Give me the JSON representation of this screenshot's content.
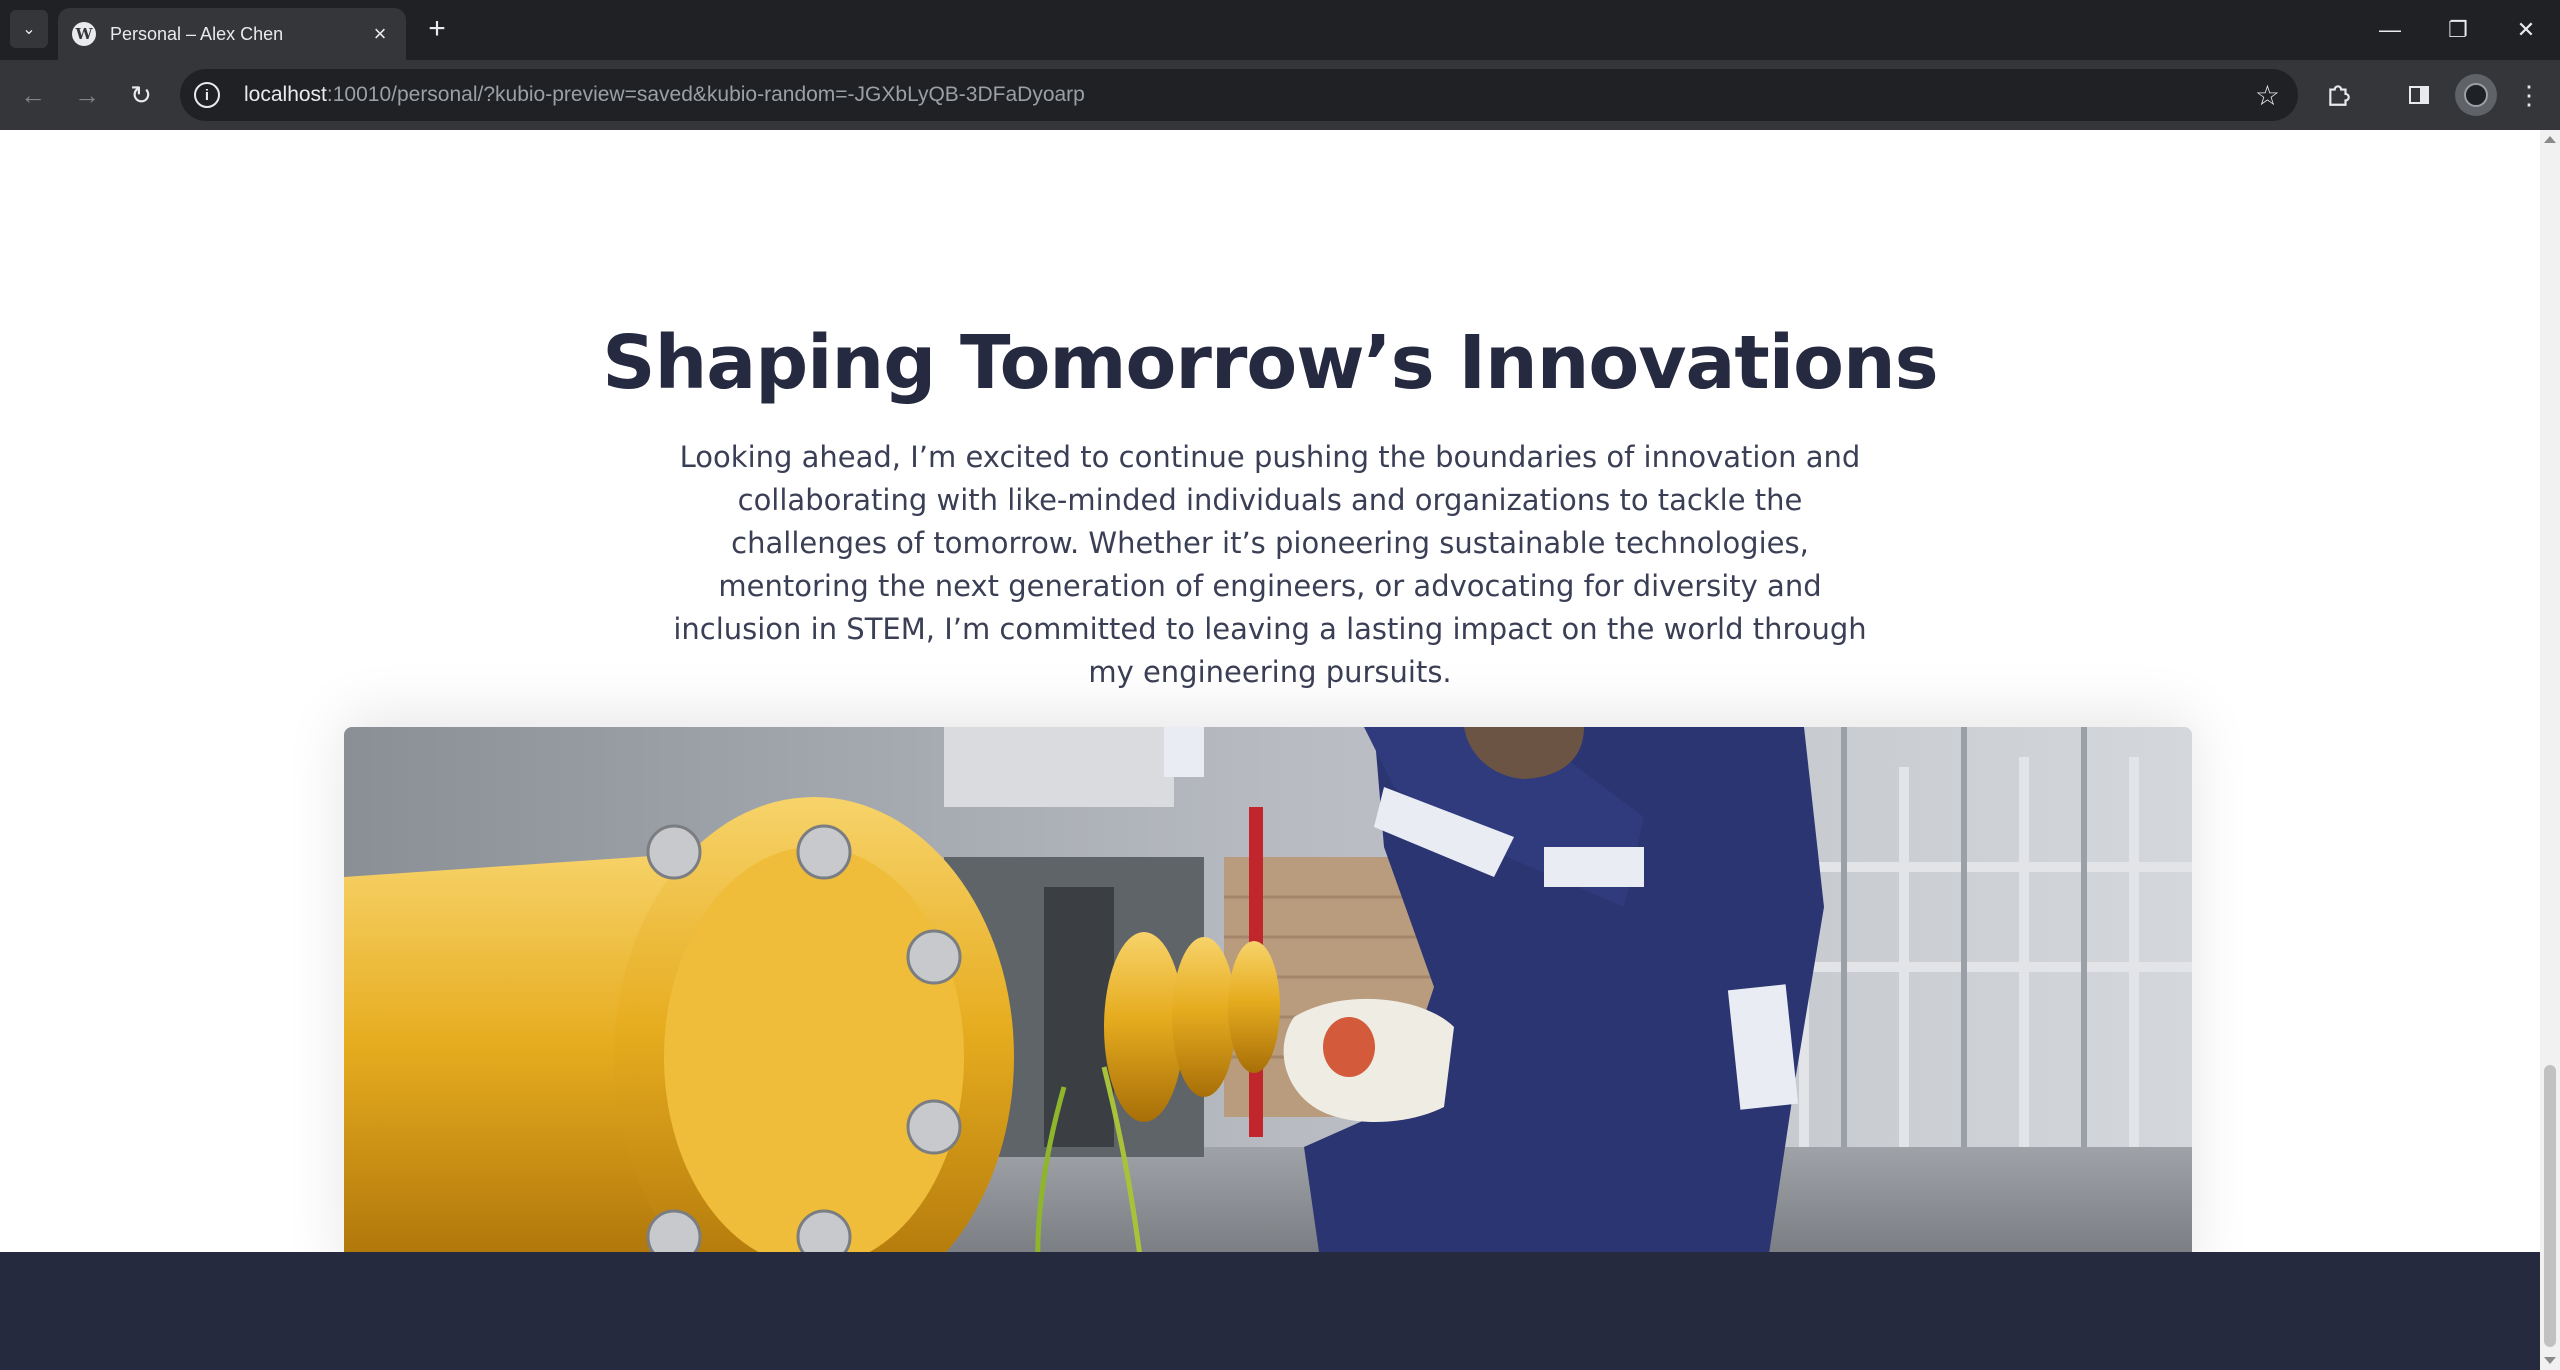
{
  "browser": {
    "tab": {
      "title": "Personal – Alex Chen",
      "favicon": "wordpress-icon"
    },
    "url": {
      "host": "localhost",
      "rest": ":10010/personal/?kubio-preview=saved&kubio-random=-JGXbLyQB-3DFaDyoarp"
    },
    "icons": {
      "tab_list": "chevron-down-icon",
      "new_tab": "plus-icon",
      "minimize": "minimize-icon",
      "restore": "restore-icon",
      "close": "close-icon",
      "back": "back-arrow-icon",
      "forward": "forward-arrow-icon",
      "reload": "reload-icon",
      "site_info": "info-icon",
      "bookmark": "star-icon",
      "extensions": "puzzle-icon",
      "side_panel": "side-panel-icon",
      "profile": "avatar",
      "menu": "kebab-menu-icon"
    }
  },
  "page": {
    "heading": "Shaping Tomorrow’s Innovations",
    "paragraph": "Looking ahead, I’m excited to continue pushing the boundaries of innovation and collaborating with like-minded individuals and organizations to tackle the challenges of tomorrow. Whether it’s pioneering sustainable technologies, mentoring the next generation of engineers, or advocating for diversity and inclusion in STEM, I’m committed to leaving a lasting impact on the world through my engineering pursuits.",
    "image_subject": "engineer in navy coveralls adjusting yellow pipeline valves in an industrial plant",
    "colors": {
      "heading": "#252a40",
      "body_text": "#3b3f55",
      "footer_bg": "#262a3f",
      "pipe_yellow": "#e6ac1f",
      "coverall_navy": "#2a3572"
    }
  }
}
